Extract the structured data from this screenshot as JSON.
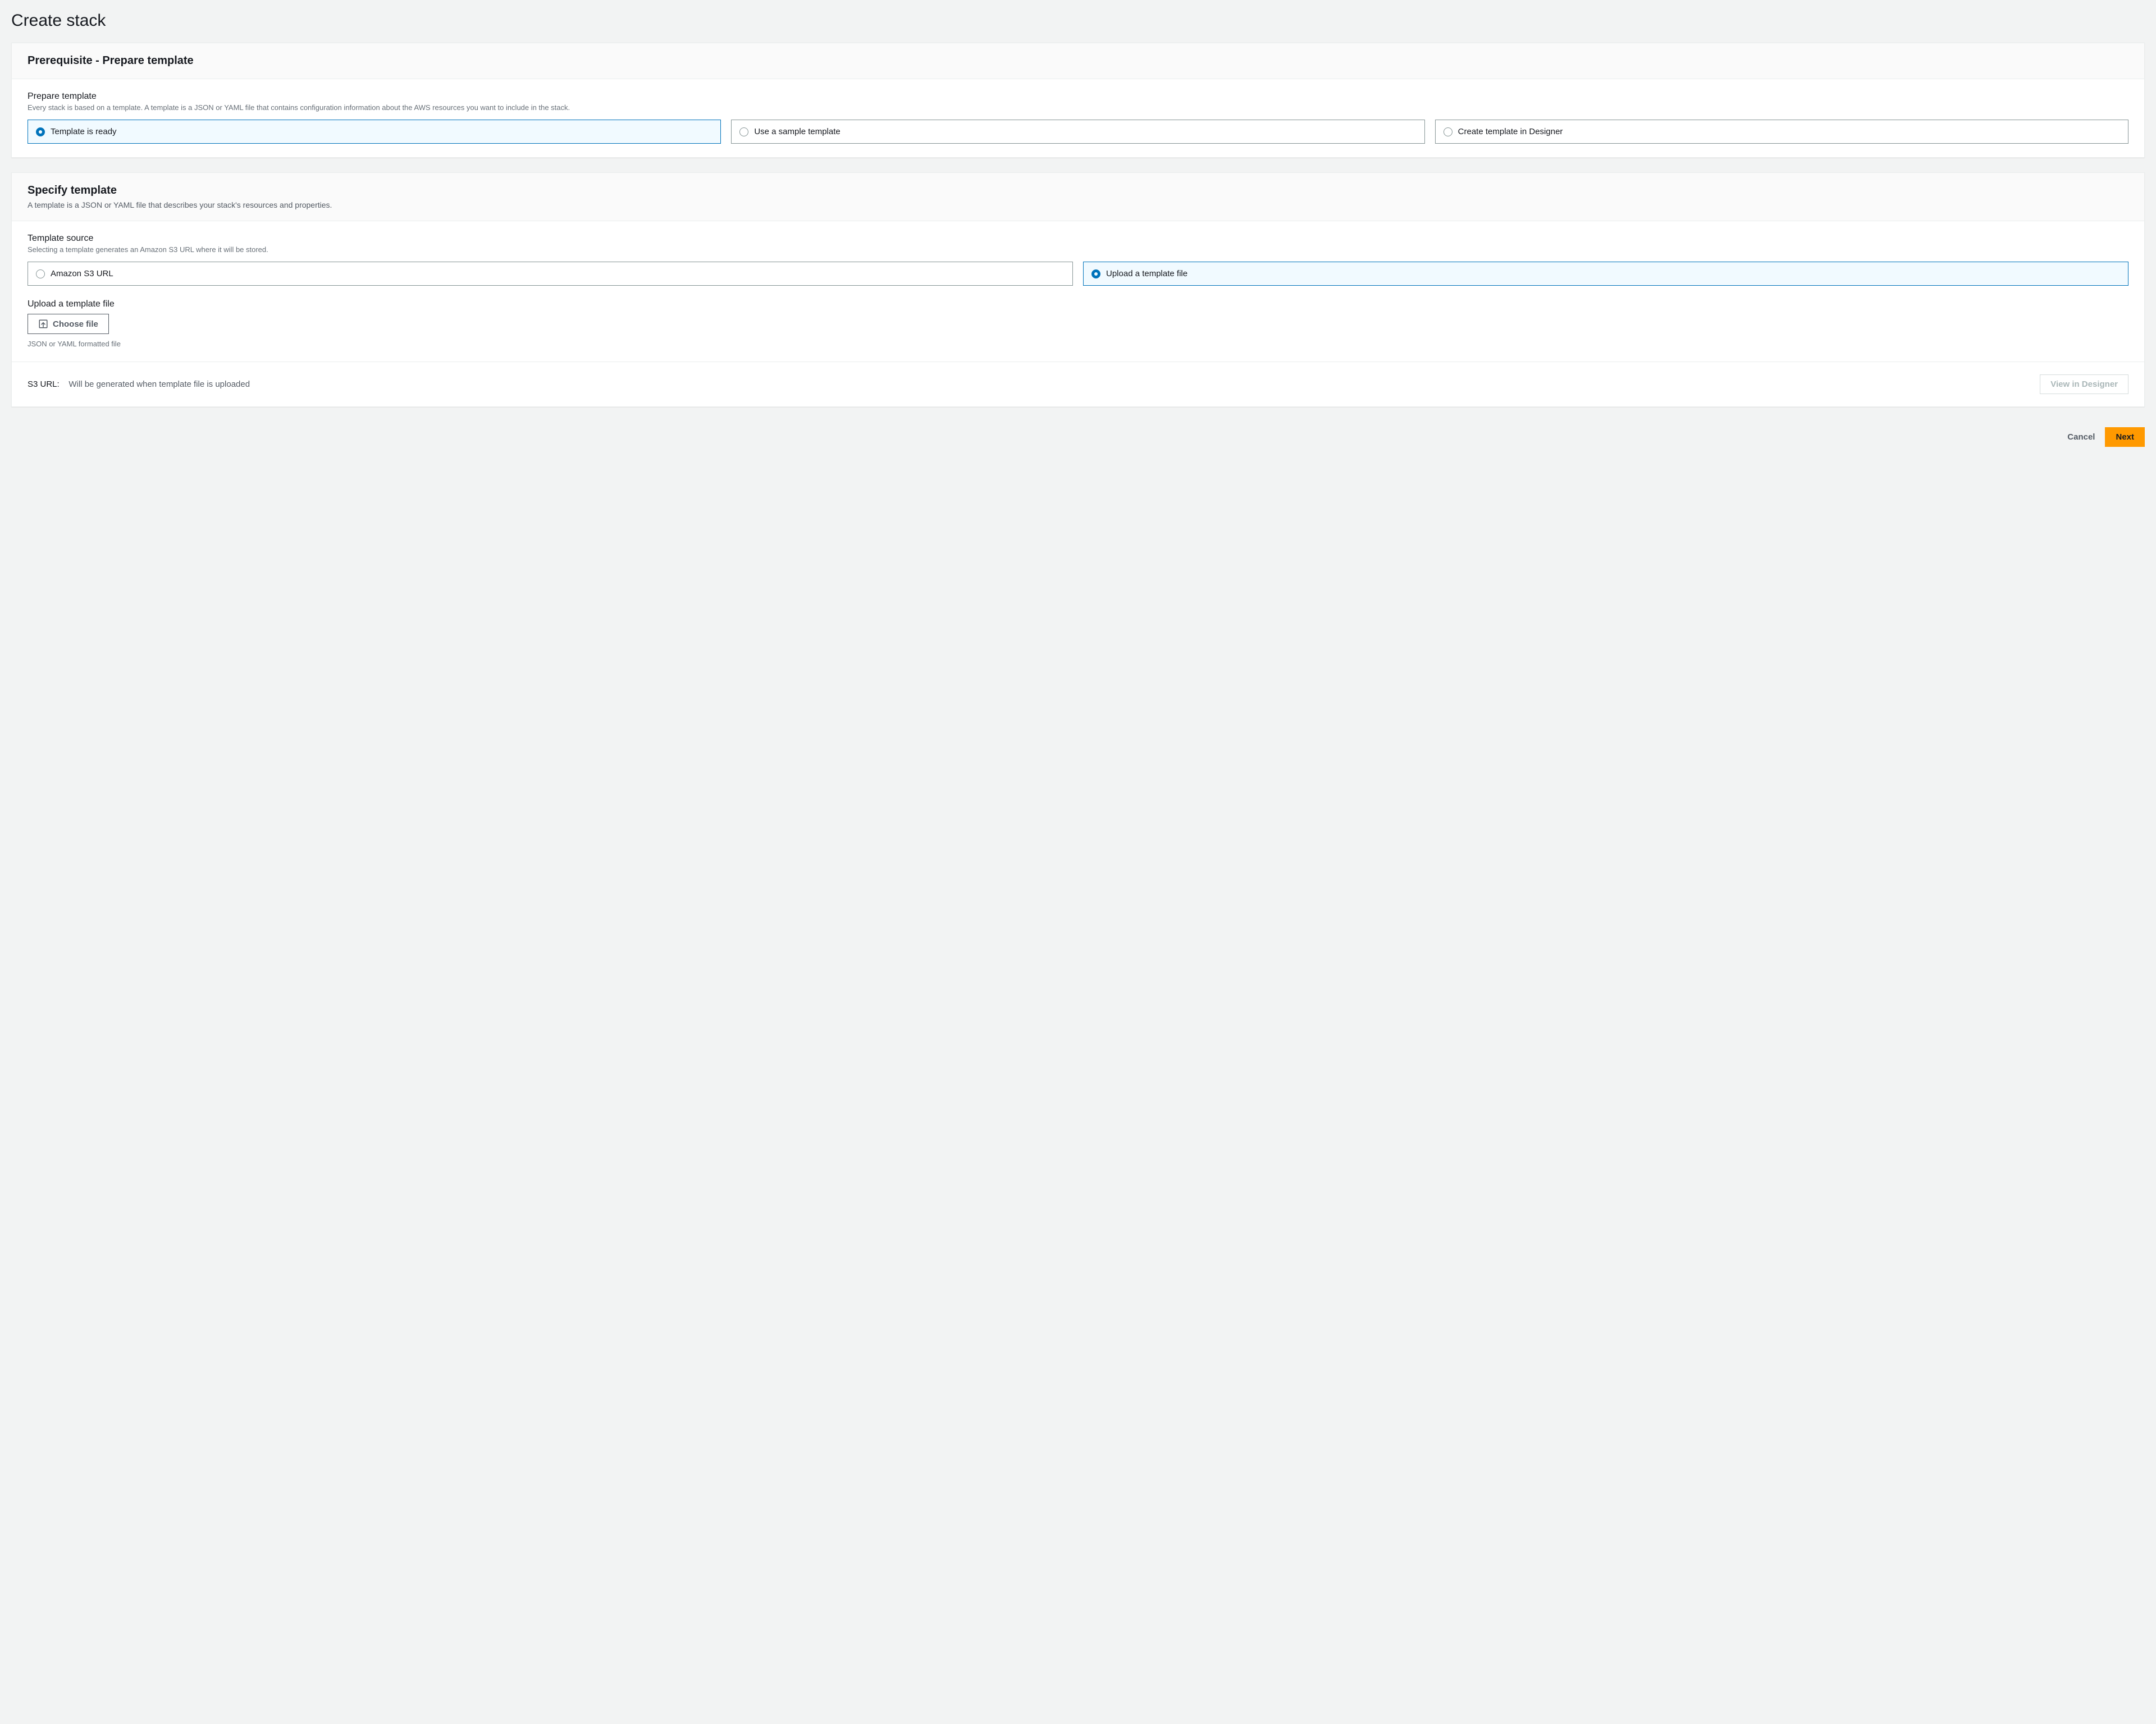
{
  "page": {
    "title": "Create stack"
  },
  "prereq": {
    "header": "Prerequisite - Prepare template",
    "section_label": "Prepare template",
    "section_desc": "Every stack is based on a template. A template is a JSON or YAML file that contains configuration information about the AWS resources you want to include in the stack.",
    "options": {
      "ready": "Template is ready",
      "sample": "Use a sample template",
      "designer": "Create template in Designer"
    }
  },
  "specify": {
    "header": "Specify template",
    "header_desc": "A template is a JSON or YAML file that describes your stack's resources and properties.",
    "source_label": "Template source",
    "source_desc": "Selecting a template generates an Amazon S3 URL where it will be stored.",
    "options": {
      "s3": "Amazon S3 URL",
      "upload": "Upload a template file"
    },
    "upload": {
      "label": "Upload a template file",
      "button": "Choose file",
      "hint": "JSON or YAML formatted file"
    },
    "s3url": {
      "label": "S3 URL:",
      "value": "Will be generated when template file is uploaded"
    },
    "view_designer": "View in Designer"
  },
  "actions": {
    "cancel": "Cancel",
    "next": "Next"
  }
}
